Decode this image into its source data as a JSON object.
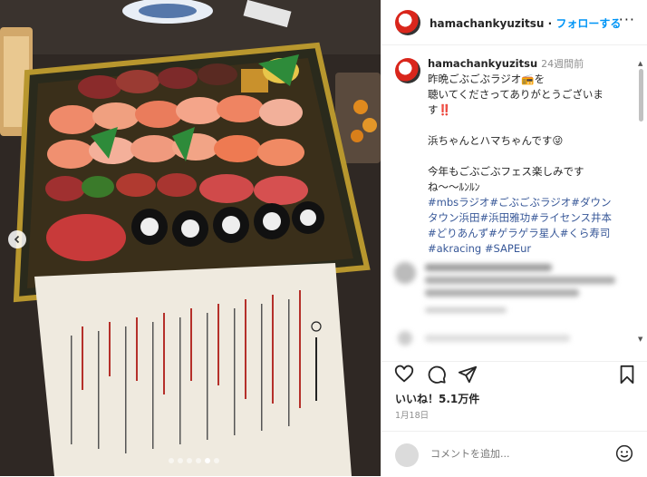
{
  "header": {
    "username": "hamachankyuzitsu",
    "separator": " · ",
    "follow_label": "フォローする",
    "more_label": "···"
  },
  "caption": {
    "username": "hamachankyuzitsu",
    "time": "24週間前",
    "lines": [
      "昨晩ごぶごぶラジオ📻を",
      "聴いてくださってありがとうございま",
      "す‼️",
      "",
      "浜ちゃんとハマちゃんです😜",
      "",
      "今年もごぶごぶフェス楽しみです",
      "ね〜〜ﾙﾝﾙﾝ"
    ],
    "hashtags": [
      "#mbsラジオ#ごぶごぶラジオ#ダウン",
      "タウン浜田#浜田雅功#ライセンス井本",
      "#どりあんず#ゲラゲラ星人#くら寿司",
      "#akracing #SAPEur"
    ]
  },
  "likes": "いいね！5.1万件",
  "date": "1月18日",
  "comment": {
    "placeholder": "コメントを追加..."
  },
  "carousel": {
    "total": 6,
    "active": 5
  },
  "menu": {
    "title": "本日のお品書き 八貫",
    "items": [
      "一、中おおとろ・赤身(みなみ鮪)",
      "一、炙りサーモン",
      "一、あかえび",
      "一、えび",
      "一、生サーモン",
      "一、カンパチ・ハマチ",
      "一、小いわし",
      "一、しめさば",
      "一、ねぎとろ(ねぎま)"
    ]
  },
  "colors": {
    "follow": "#0095f6",
    "hashtag": "#385898",
    "text": "#262626",
    "muted": "#8e8e8e"
  }
}
